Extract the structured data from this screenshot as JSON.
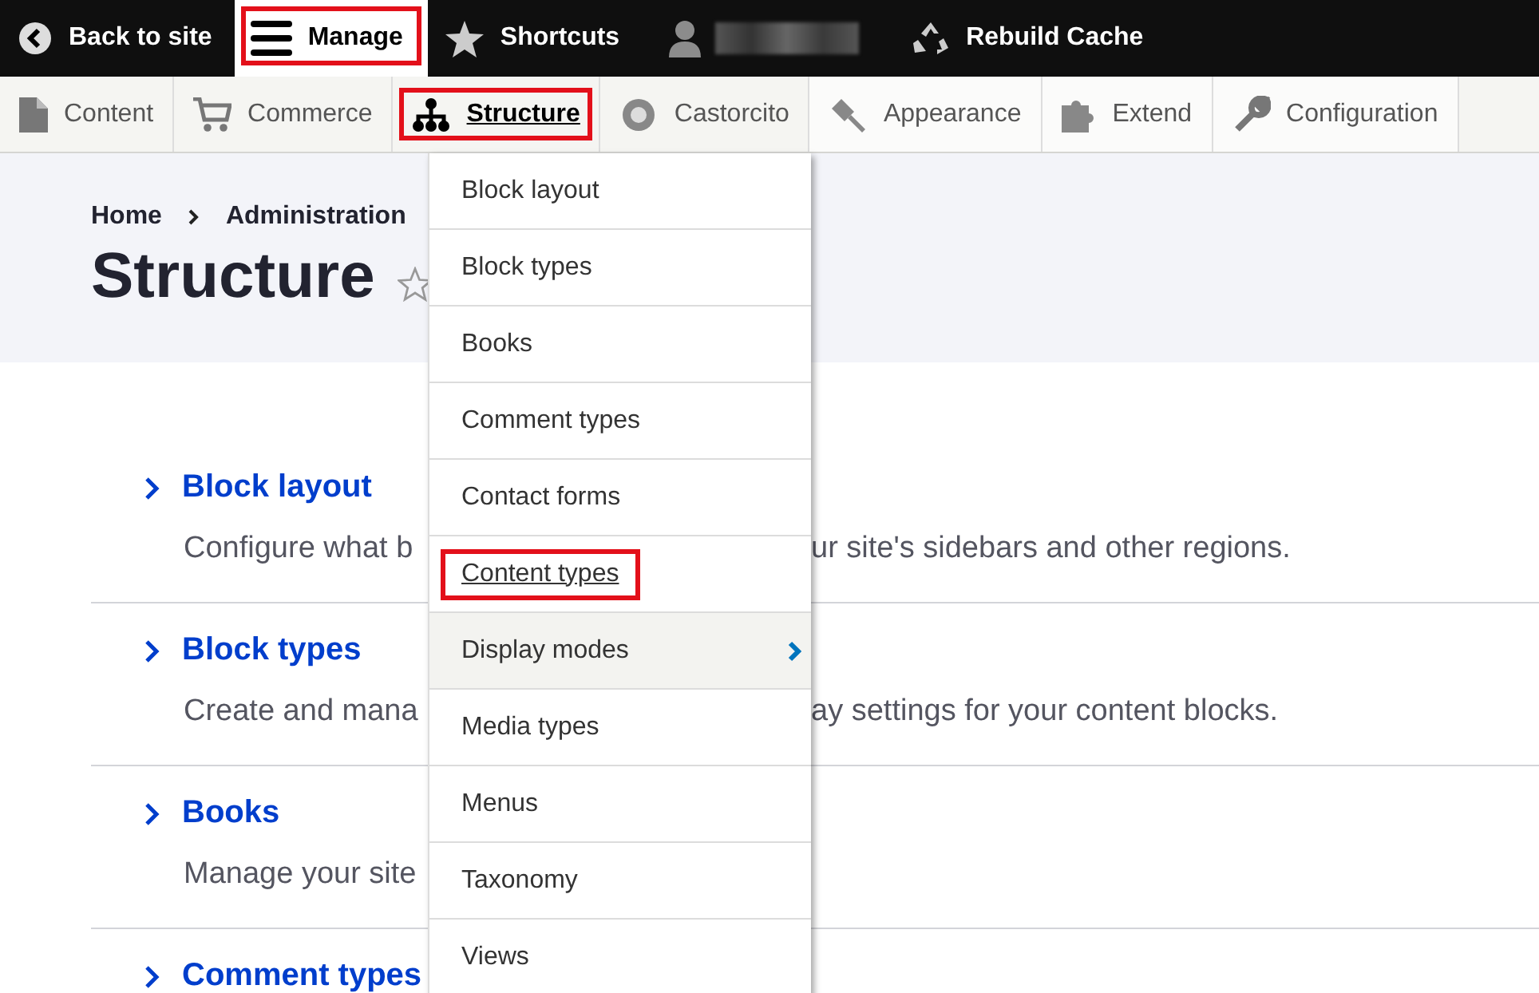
{
  "toolbar": {
    "items": [
      {
        "label": "Back to site",
        "selected": false,
        "highlighted": false
      },
      {
        "label": "Manage",
        "selected": true,
        "highlighted": true
      },
      {
        "label": "Shortcuts",
        "selected": false,
        "highlighted": false
      },
      {
        "kind": "user"
      },
      {
        "label": "Rebuild Cache",
        "selected": false,
        "highlighted": false
      }
    ]
  },
  "tray": {
    "items": [
      {
        "label": "Content",
        "selected": false,
        "highlighted": false
      },
      {
        "label": "Commerce",
        "selected": false,
        "highlighted": false
      },
      {
        "label": "Structure",
        "selected": true,
        "highlighted": true
      },
      {
        "label": "Castorcito",
        "selected": false,
        "highlighted": false
      },
      {
        "label": "Appearance",
        "selected": false,
        "highlighted": false
      },
      {
        "label": "Extend",
        "selected": false,
        "highlighted": false
      },
      {
        "label": "Configuration",
        "selected": false,
        "highlighted": false
      }
    ]
  },
  "breadcrumb": [
    "Home",
    "Administration"
  ],
  "page_title": "Structure",
  "admin_list": [
    {
      "title": "Block layout",
      "description_start": "Configure what b",
      "description_end": "ur site's sidebars and other regions."
    },
    {
      "title": "Block types",
      "description_start": "Create and mana",
      "description_end": "ay settings for your content blocks."
    },
    {
      "title": "Books",
      "description_start": "Manage your site"
    },
    {
      "title": "Comment types"
    }
  ],
  "dropdown": {
    "items": [
      {
        "label": "Block layout",
        "focused": false,
        "hovered": false,
        "has_submenu": false,
        "highlighted": false
      },
      {
        "label": "Block types",
        "focused": false,
        "hovered": false,
        "has_submenu": false,
        "highlighted": false
      },
      {
        "label": "Books",
        "focused": false,
        "hovered": false,
        "has_submenu": false,
        "highlighted": false
      },
      {
        "label": "Comment types",
        "focused": false,
        "hovered": false,
        "has_submenu": false,
        "highlighted": false
      },
      {
        "label": "Contact forms",
        "focused": false,
        "hovered": false,
        "has_submenu": false,
        "highlighted": false
      },
      {
        "label": "Content types",
        "focused": true,
        "hovered": false,
        "has_submenu": false,
        "highlighted": true
      },
      {
        "label": "Display modes",
        "focused": false,
        "hovered": true,
        "has_submenu": true,
        "highlighted": false
      },
      {
        "label": "Media types",
        "focused": false,
        "hovered": false,
        "has_submenu": false,
        "highlighted": false
      },
      {
        "label": "Menus",
        "focused": false,
        "hovered": false,
        "has_submenu": false,
        "highlighted": false
      },
      {
        "label": "Taxonomy",
        "focused": false,
        "hovered": false,
        "has_submenu": false,
        "highlighted": false
      },
      {
        "label": "Views",
        "focused": false,
        "hovered": false,
        "has_submenu": false,
        "highlighted": false
      }
    ]
  }
}
